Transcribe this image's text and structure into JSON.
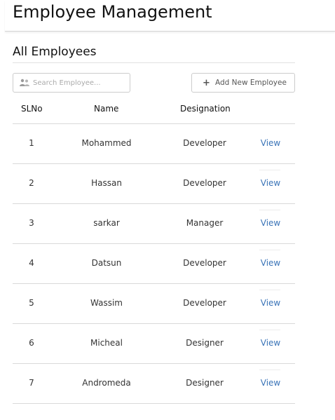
{
  "app": {
    "title": "Employee Management"
  },
  "section": {
    "title": "All Employees"
  },
  "search": {
    "placeholder": "Search Employee..."
  },
  "toolbar": {
    "add_label": "Add New Employee"
  },
  "table": {
    "headers": {
      "sl": "SLNo",
      "name": "Name",
      "designation": "Designation"
    },
    "rows": [
      {
        "sl": "1",
        "name": "Mohammed",
        "designation": "Developer",
        "action": "View"
      },
      {
        "sl": "2",
        "name": "Hassan",
        "designation": "Developer",
        "action": "View"
      },
      {
        "sl": "3",
        "name": "sarkar",
        "designation": "Manager",
        "action": "View"
      },
      {
        "sl": "4",
        "name": "Datsun",
        "designation": "Developer",
        "action": "View"
      },
      {
        "sl": "5",
        "name": "Wassim",
        "designation": "Developer",
        "action": "View"
      },
      {
        "sl": "6",
        "name": "Micheal",
        "designation": "Designer",
        "action": "View"
      },
      {
        "sl": "7",
        "name": "Andromeda",
        "designation": "Designer",
        "action": "View"
      }
    ]
  },
  "icons": {
    "search": "users-icon",
    "add": "plus-icon"
  },
  "colors": {
    "link": "#3a74b8",
    "border": "#cccccc",
    "divider": "#d9d9d9"
  }
}
